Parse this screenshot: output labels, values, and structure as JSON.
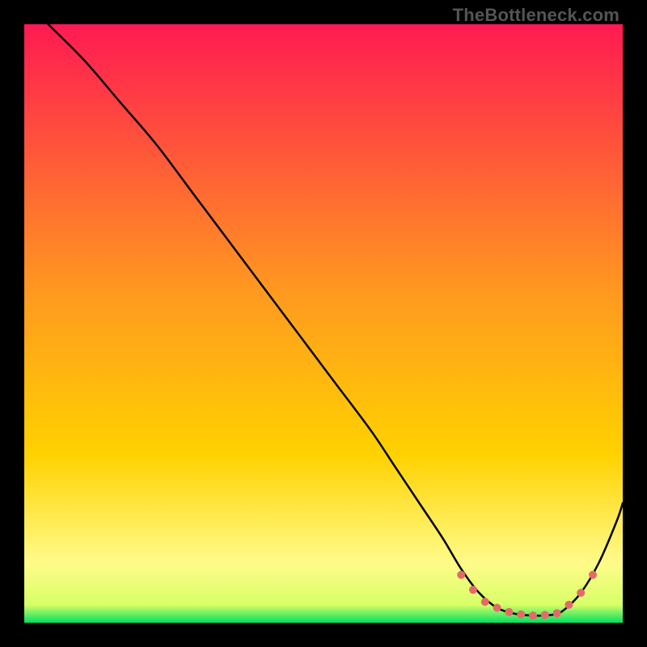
{
  "watermark": "TheBottleneck.com",
  "chart_data": {
    "type": "line",
    "title": "",
    "xlabel": "",
    "ylabel": "",
    "xlim": [
      0,
      100
    ],
    "ylim": [
      0,
      100
    ],
    "grid": false,
    "legend": false,
    "background_gradient": {
      "top_color": "#ff1a52",
      "mid_color": "#ffd200",
      "lower_color": "#fffb8a",
      "bottom_color": "#00e060"
    },
    "series": [
      {
        "name": "bottleneck-curve",
        "color": "#000000",
        "x": [
          4,
          10,
          16,
          22,
          28,
          34,
          40,
          46,
          52,
          58,
          62,
          66,
          70,
          73,
          76,
          79,
          82,
          85,
          88,
          90,
          93,
          96,
          99,
          100
        ],
        "y": [
          100,
          94,
          87,
          80,
          72,
          64,
          56,
          48,
          40,
          32,
          26,
          20,
          14,
          9,
          5,
          2.5,
          1.5,
          1.2,
          1.3,
          2,
          5,
          10,
          17,
          20
        ]
      }
    ],
    "markers": {
      "name": "optimal-range-dots",
      "color": "#e46a6a",
      "x": [
        73,
        75,
        77,
        79,
        81,
        83,
        85,
        87,
        89,
        91,
        93,
        95
      ],
      "y": [
        8,
        5.5,
        3.5,
        2.5,
        1.8,
        1.4,
        1.2,
        1.3,
        1.6,
        3.0,
        5.0,
        8.0
      ]
    }
  }
}
